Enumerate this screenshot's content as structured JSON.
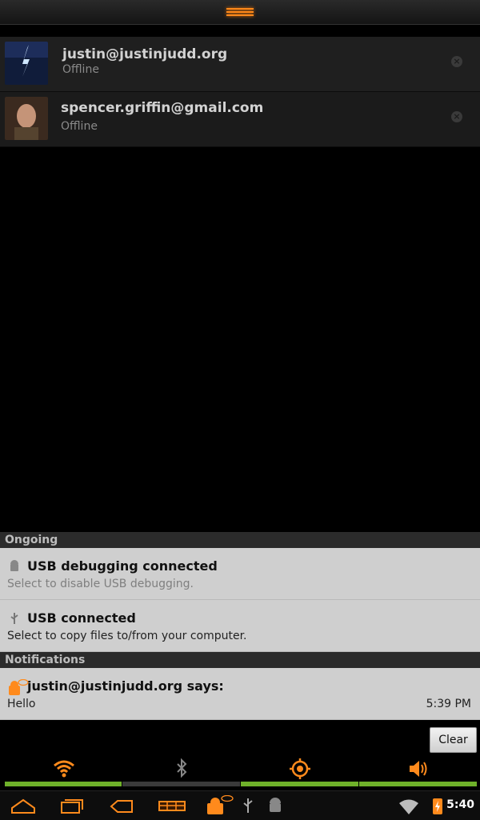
{
  "contacts": [
    {
      "name": "justin@justinjudd.org",
      "status": "Offline"
    },
    {
      "name": "spencer.griffin@gmail.com",
      "status": "Offline"
    }
  ],
  "ongoing": {
    "header": "Ongoing",
    "items": [
      {
        "title": "USB debugging connected",
        "subtitle": "Select to disable USB debugging."
      },
      {
        "title": "USB connected",
        "subtitle": "Select to copy files to/from your computer."
      }
    ]
  },
  "notifications": {
    "header": "Notifications",
    "items": [
      {
        "title": "justin@justinjudd.org says:",
        "message": "Hello",
        "time": "5:39 PM"
      }
    ]
  },
  "clear_label": "Clear",
  "quick_settings": [
    {
      "name": "wifi",
      "enabled": true
    },
    {
      "name": "bluetooth",
      "enabled": false
    },
    {
      "name": "gps",
      "enabled": true
    },
    {
      "name": "sound",
      "enabled": true
    }
  ],
  "status_bar": {
    "clock": "5:40"
  },
  "colors": {
    "accent": "#ff8a1c",
    "toggle_on": "#6fb12a",
    "toggle_off": "#3a3a3a"
  }
}
